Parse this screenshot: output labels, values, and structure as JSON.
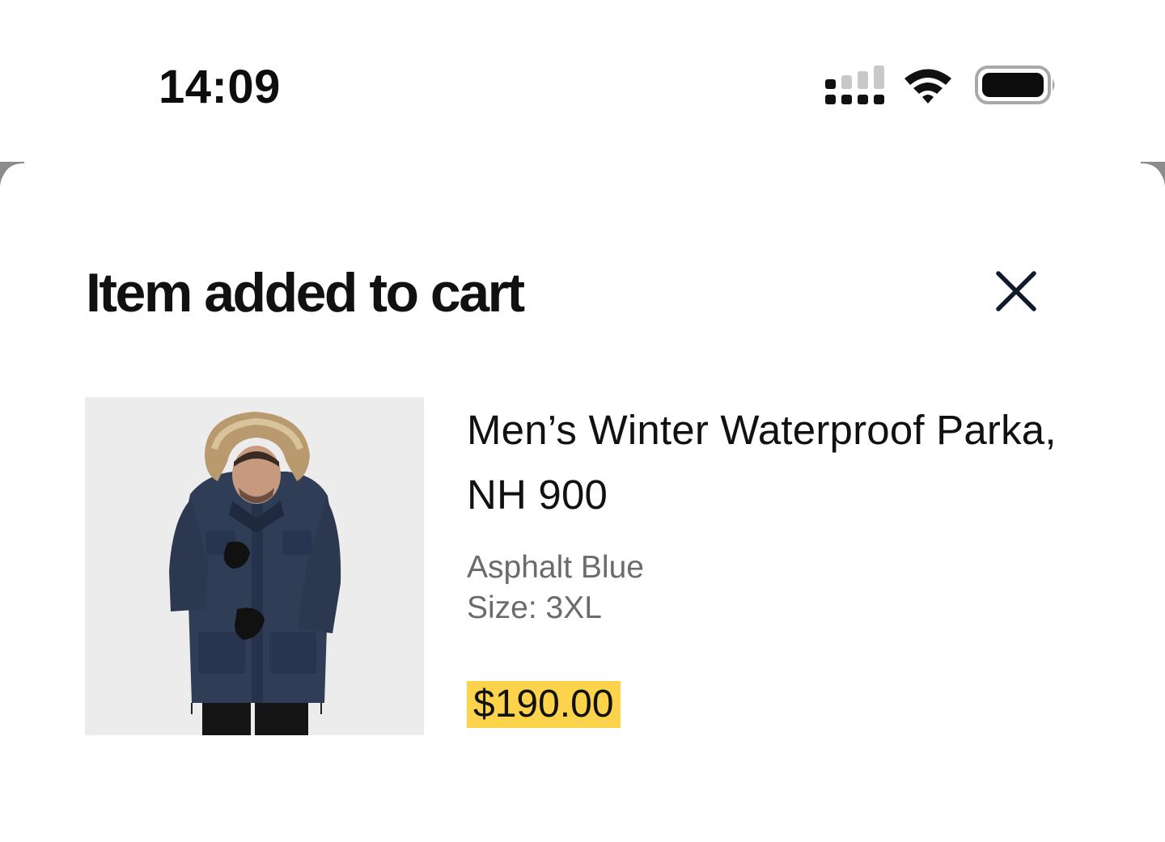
{
  "status_bar": {
    "time": "14:09",
    "signal_icon": "cellular-signal-icon",
    "wifi_icon": "wifi-icon",
    "battery_icon": "battery-icon"
  },
  "sheet": {
    "title": "Item added to cart",
    "close_icon": "close-icon"
  },
  "product": {
    "name": "Men’s Winter Waterproof Parka, NH 900",
    "color": "Asphalt Blue",
    "size": "Size: 3XL",
    "price": "$190.00",
    "image_alt": "Man wearing a navy blue parka with a fur-trimmed hood"
  },
  "colors": {
    "price_highlight": "#fcd34a",
    "image_background": "#ececec",
    "jacket": "#2f3d56"
  }
}
